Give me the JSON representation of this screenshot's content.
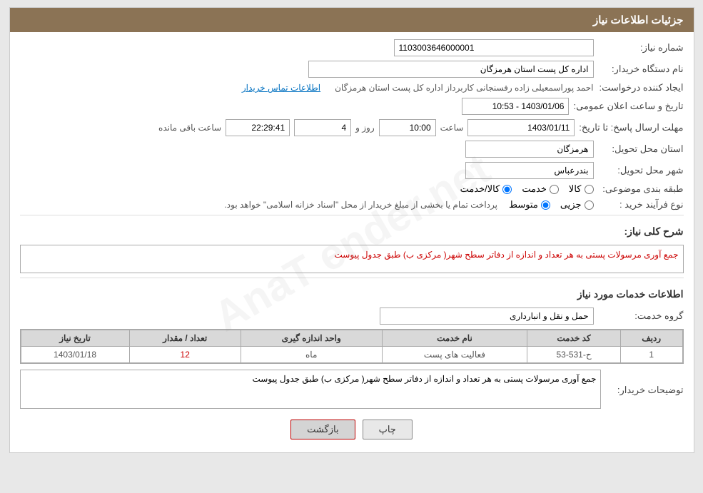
{
  "header": {
    "title": "جزئیات اطلاعات نیاز"
  },
  "fields": {
    "need_number_label": "شماره نیاز:",
    "need_number_value": "1103003646000001",
    "buyer_label": "نام دستگاه خریدار:",
    "buyer_value": "",
    "creator_label": "ایجاد کننده درخواست:",
    "creator_value": "احمد پوراسمعیلی زاده رفسنجانی کاربرداز اداره کل پست استان هرمزگان",
    "contact_link": "اطلاعات تماس خریدار",
    "publish_label": "تاریخ و ساعت اعلان عمومی:",
    "publish_value": "1403/01/06 - 10:53",
    "deadline_label": "مهلت ارسال پاسخ: تا تاریخ:",
    "deadline_date": "1403/01/11",
    "deadline_time_label": "ساعت",
    "deadline_time": "10:00",
    "deadline_day_label": "روز و",
    "deadline_days": "4",
    "deadline_remaining_label": "ساعت باقی مانده",
    "deadline_remaining": "22:29:41",
    "province_label": "استان محل تحویل:",
    "province_value": "هرمزگان",
    "city_label": "شهر محل تحویل:",
    "city_value": "بندرعباس",
    "category_label": "طبقه بندی موضوعی:",
    "category_options": [
      "کالا",
      "خدمت",
      "کالا/خدمت"
    ],
    "category_selected": "کالا",
    "purchase_type_label": "نوع فرآیند خرید :",
    "purchase_type_options": [
      "جزیی",
      "متوسط"
    ],
    "purchase_type_note": "پرداخت تمام یا بخشی از مبلغ خریدار از محل \"اسناد خزانه اسلامی\" خواهد بود.",
    "need_desc_label": "شرح کلی نیاز:",
    "need_desc_value": "جمع آوری مرسولات پستی به هر تعداد و اندازه از دفاتر سطح شهر( مرکزی ب) طبق جدول پیوست",
    "services_label": "اطلاعات خدمات مورد نیاز",
    "service_group_label": "گروه خدمت:",
    "service_group_value": "حمل و نقل و انبارداری",
    "table": {
      "columns": [
        "ردیف",
        "کد خدمت",
        "نام خدمت",
        "واحد اندازه گیری",
        "تعداد / مقدار",
        "تاریخ نیاز"
      ],
      "rows": [
        {
          "row": "1",
          "code": "ح-531-53",
          "name": "فعالیت های پست",
          "unit": "ماه",
          "quantity": "12",
          "date": "1403/01/18"
        }
      ]
    },
    "buyer_desc_label": "توضیحات خریدار:",
    "buyer_desc_value": "جمع آوری مرسولات پستی به هر تعداد و اندازه از دفاتر سطح شهر( مرکزی ب) طبق جدول پیوست"
  },
  "buttons": {
    "print": "چاپ",
    "back": "بازگشت"
  }
}
